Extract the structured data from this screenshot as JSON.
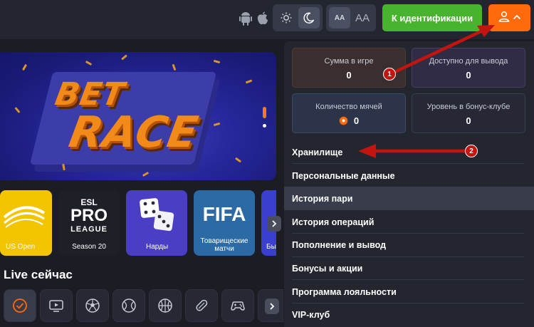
{
  "topbar": {
    "platform_icons": [
      "android-icon",
      "apple-icon"
    ],
    "theme_icons": [
      "sun-icon",
      "moon-icon"
    ],
    "font_size_buttons": [
      "AA",
      "AA"
    ],
    "identification_button": "К идентификации",
    "user_icons": [
      "user-icon",
      "chevron-up-icon"
    ]
  },
  "banner": {
    "word1": "BET",
    "word2": "RACE"
  },
  "categories": [
    {
      "label": "US Open"
    },
    {
      "label": "Season 20",
      "logo_top": "ESL",
      "logo_mid": "PRO",
      "logo_bottom": "LEAGUE"
    },
    {
      "label": "Нарды"
    },
    {
      "label": "Товарищеские матчи",
      "logo": "FIFA"
    },
    {
      "label": "Бы"
    }
  ],
  "live": {
    "title": "Live сейчас",
    "sport_icons": [
      "check-icon",
      "tv-icon",
      "soccer-ball-icon",
      "tennis-ball-icon",
      "basketball-icon",
      "table-tennis-icon",
      "gamepad-icon"
    ]
  },
  "panel": {
    "stats": [
      {
        "label": "Сумма в игре",
        "value": "0"
      },
      {
        "label": "Доступно для вывода",
        "value": "0"
      },
      {
        "label": "Количество мячей",
        "value": "0"
      },
      {
        "label": "Уровень в бонус-клубе",
        "value": "0"
      }
    ],
    "menu": [
      "Хранилище",
      "Персональные данные",
      "История пари",
      "История операций",
      "Пополнение и вывод",
      "Бонусы и акции",
      "Программа лояльности",
      "VIP-клуб"
    ]
  },
  "annotations": [
    "1",
    "2"
  ],
  "colors": {
    "accent_orange": "#ff6a0a",
    "accent_green": "#47b32f",
    "annotation_red": "#c2150f"
  }
}
